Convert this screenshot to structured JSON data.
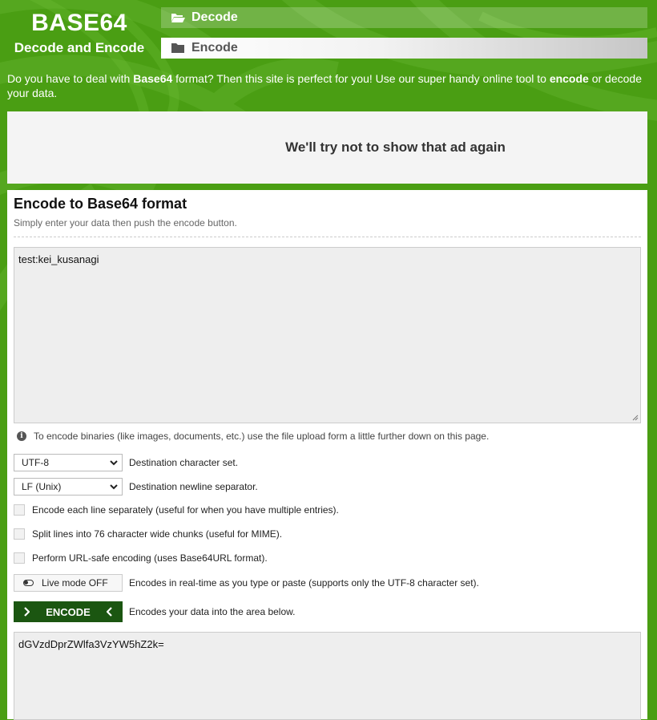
{
  "logo": {
    "title": "BASE64",
    "subtitle": "Decode and Encode"
  },
  "nav": {
    "decode_label": "Decode",
    "encode_label": "Encode"
  },
  "intro": {
    "p1": "Do you have to deal with ",
    "b1": "Base64",
    "p2": " format? Then this site is perfect for you! Use our super handy online tool to ",
    "b2": "encode",
    "p3": " or decode your data."
  },
  "ad": {
    "message": "We'll try not to show that ad again"
  },
  "encoder": {
    "heading": "Encode to Base64 format",
    "subheading": "Simply enter your data then push the encode button.",
    "input_value": "test:kei_kusanagi",
    "info_text": "To encode binaries (like images, documents, etc.) use the file upload form a little further down on this page.",
    "charset_value": "UTF-8",
    "charset_label": "Destination character set.",
    "newline_value": "LF (Unix)",
    "newline_label": "Destination newline separator.",
    "opt_each_line": "Encode each line separately (useful for when you have multiple entries).",
    "opt_split": "Split lines into 76 character wide chunks (useful for MIME).",
    "opt_urlsafe": "Perform URL-safe encoding (uses Base64URL format).",
    "live_label": "Live mode OFF",
    "live_desc": "Encodes in real-time as you type or paste (supports only the UTF-8 character set).",
    "encode_button": "ENCODE",
    "encode_desc": "Encodes your data into the area below.",
    "output_value": "dGVzdDprZWlfa3VzYW5hZ2k="
  },
  "colors": {
    "brand_green": "#4a9e13",
    "button_dark_green": "#1b5611"
  }
}
